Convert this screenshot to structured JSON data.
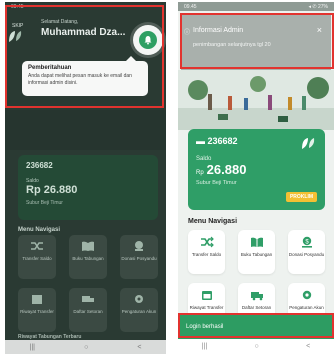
{
  "left": {
    "status": {
      "time": "09.45",
      "right": ""
    },
    "skip": "SKIP",
    "welcome": "Selamat Datang,",
    "name": "Muhammad Dza...",
    "tooltip": {
      "title": "Pemberitahuan",
      "body": "Anda dapat melihat pesan masuk ke email dan informasi admin disini."
    },
    "card": {
      "account": "236682",
      "saldo_label": "Saldo",
      "amount": "Rp 26.880",
      "sub": "Subur Beji Timur"
    },
    "menu_title": "Menu Navigasi",
    "tiles": [
      "Transfer Saldo",
      "Buku Tabungan",
      "Donasi Posyandu",
      "Riwayat Transfer",
      "Daftar Setoran",
      "Pengaturan Akun"
    ],
    "history_title": "Riwayat Tabungan Terbaru",
    "nav": [
      "|||",
      "○",
      "<"
    ]
  },
  "right": {
    "status": {
      "time": "09.45",
      "right": "◂ ✆ 27%"
    },
    "info_title": "Informasi Admin",
    "info_body": "penimbangan selanjutnya tgl 20",
    "close": "×",
    "card": {
      "account": "236682",
      "saldo_label": "Saldo",
      "currency": "Rp",
      "amount": "26.880",
      "sub": "Subur Beji Timur",
      "badge": "PROKLIM"
    },
    "menu_title": "Menu Navigasi",
    "tiles": [
      "Transfer Saldo",
      "Buku Tabungan",
      "Donasi Posyandu",
      "Riwayat Transfer",
      "Daftar Setoran",
      "Pengaturan Akun"
    ],
    "snackbar": "Login berhasil",
    "nav": [
      "|||",
      "○",
      "<"
    ]
  },
  "colors": {
    "brand_green": "#2f9e67",
    "highlight_red": "#e2332f",
    "badge_yellow": "#f3c033"
  }
}
